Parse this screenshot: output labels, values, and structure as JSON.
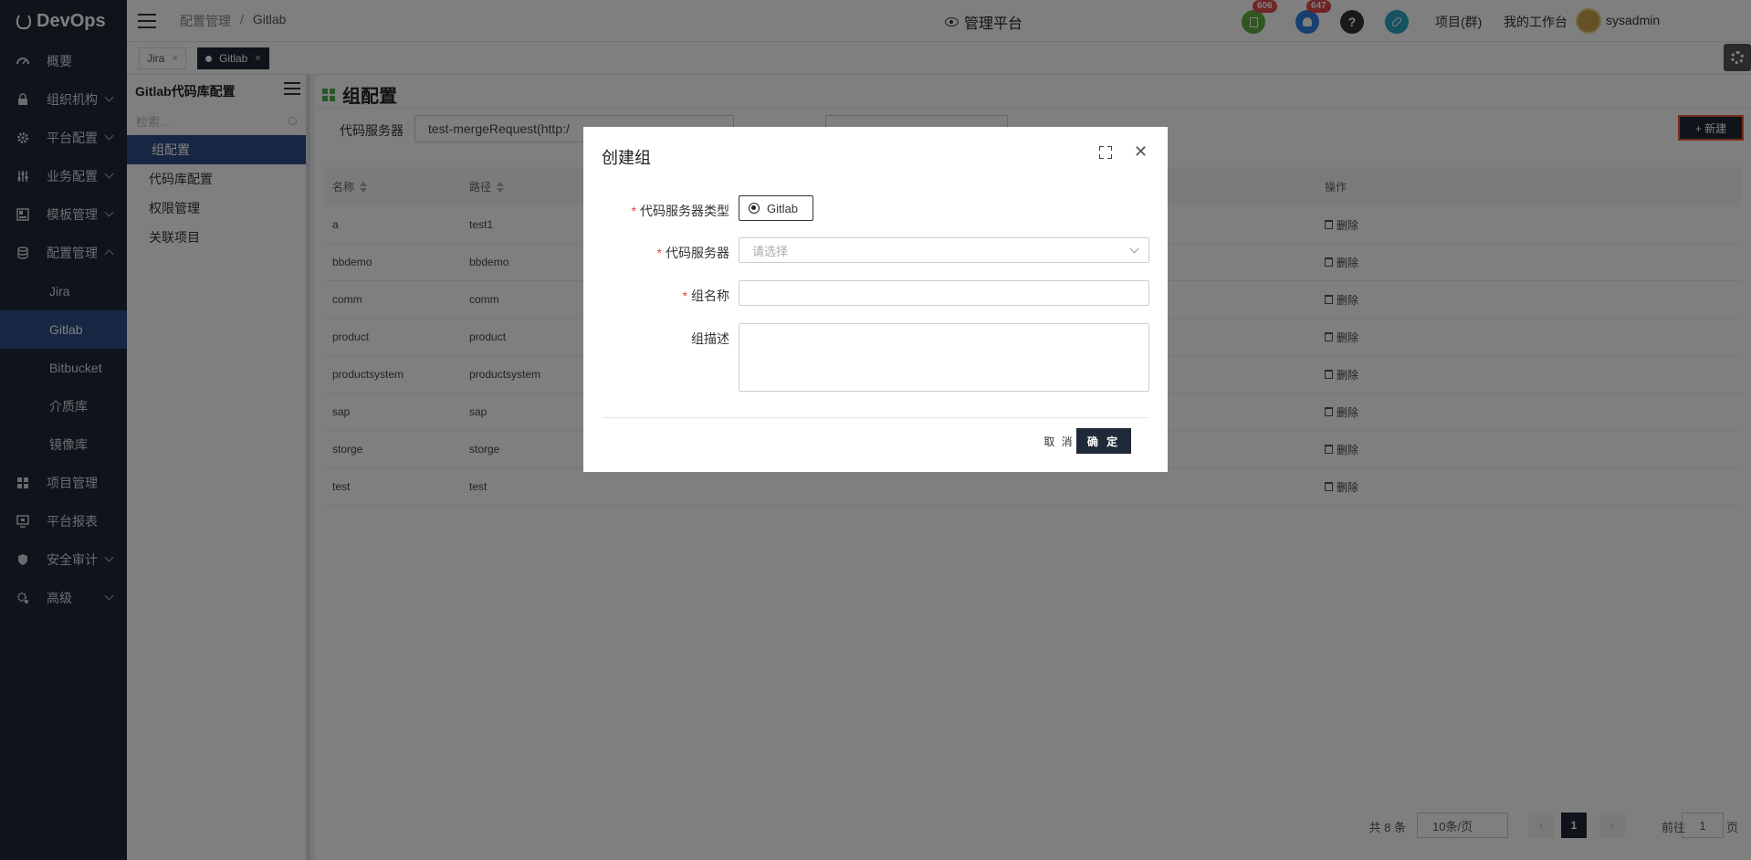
{
  "app": {
    "logo": "DevOps"
  },
  "sidebar": {
    "items": [
      {
        "label": "概要",
        "icon": "dashboard-icon"
      },
      {
        "label": "组织机构",
        "icon": "lock-icon",
        "expandable": true
      },
      {
        "label": "平台配置",
        "icon": "gear-icon",
        "expandable": true
      },
      {
        "label": "业务配置",
        "icon": "sliders-icon",
        "expandable": true
      },
      {
        "label": "模板管理",
        "icon": "template-icon",
        "expandable": true
      },
      {
        "label": "配置管理",
        "icon": "database-icon",
        "expanded": true
      }
    ],
    "sub_items": [
      "Jira",
      "Gitlab",
      "Bitbucket",
      "介质库",
      "镜像库"
    ],
    "active_sub": "Gitlab",
    "items_after": [
      {
        "label": "项目管理",
        "icon": "grid-icon"
      },
      {
        "label": "平台报表",
        "icon": "monitor-icon"
      },
      {
        "label": "安全审计",
        "icon": "shield-icon",
        "expandable": true
      },
      {
        "label": "高级",
        "icon": "advanced-icon",
        "expandable": true
      }
    ]
  },
  "header": {
    "breadcrumb": [
      "配置管理",
      "/",
      "Gitlab"
    ],
    "center_title": "管理平台",
    "badges": {
      "tasks": "606",
      "notifications": "647"
    },
    "links": [
      "项目(群)",
      "我的工作台"
    ],
    "user": "sysadmin"
  },
  "tabs": [
    {
      "label": "Jira",
      "close": "×"
    },
    {
      "label": "Gitlab",
      "close": "×"
    }
  ],
  "config_panel": {
    "title": "Gitlab代码库配置",
    "search_placeholder": "检索...",
    "items": [
      "组配置",
      "代码库配置",
      "权限管理",
      "关联项目"
    ]
  },
  "main": {
    "title": "组配置",
    "filter_label": "代码服务器",
    "filter_value": "test-mergeRequest(http:/",
    "new_button": "+ 新建",
    "table": {
      "headers": {
        "name": "名称",
        "path": "路径",
        "op": "操作"
      },
      "rows": [
        {
          "name": "a",
          "path": "test1"
        },
        {
          "name": "bbdemo",
          "path": "bbdemo"
        },
        {
          "name": "comm",
          "path": "comm"
        },
        {
          "name": "product",
          "path": "product"
        },
        {
          "name": "productsystem",
          "path": "productsystem"
        },
        {
          "name": "sap",
          "path": "sap"
        },
        {
          "name": "storge",
          "path": "storge"
        },
        {
          "name": "test",
          "path": "test"
        }
      ],
      "delete_label": "删除"
    },
    "pager": {
      "total": "共 8 条",
      "page_size": "10条/页",
      "current": "1",
      "goto_label": "前往",
      "goto_value": "1",
      "page_suffix": "页"
    }
  },
  "modal": {
    "title": "创建组",
    "fields": {
      "server_type_label": "代码服务器类型",
      "server_type_value": "Gitlab",
      "server_label": "代码服务器",
      "server_placeholder": "请选择",
      "name_label": "组名称",
      "desc_label": "组描述"
    },
    "required_mark": "*",
    "cancel": "取 消",
    "ok": "确 定"
  }
}
